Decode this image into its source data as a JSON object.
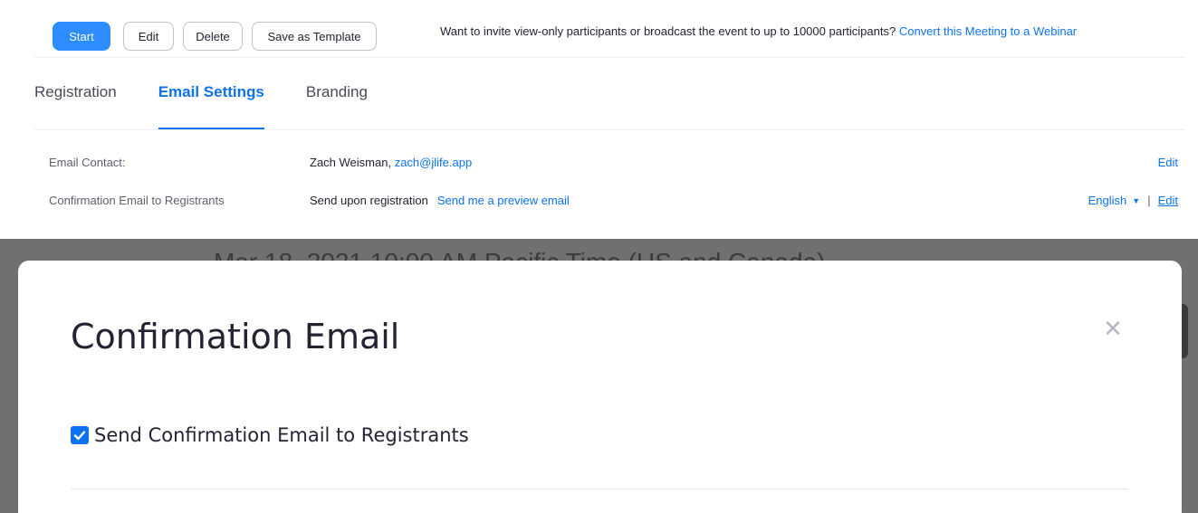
{
  "toolbar": {
    "start_label": "Start",
    "edit_label": "Edit",
    "delete_label": "Delete",
    "template_label": "Save as Template",
    "invite_text": "Want to invite view-only participants or broadcast the event to up to 10000 participants?",
    "convert_link": "Convert this Meeting to a Webinar"
  },
  "tabs": [
    {
      "label": "Registration",
      "active": false
    },
    {
      "label": "Email Settings",
      "active": true
    },
    {
      "label": "Branding",
      "active": false
    }
  ],
  "email_settings": {
    "contact": {
      "label": "Email Contact:",
      "name": "Zach Weisman,",
      "email": "zach@jlife.app",
      "edit_label": "Edit"
    },
    "confirmation": {
      "label": "Confirmation Email to Registrants",
      "status": "Send upon registration",
      "preview_link": "Send me a preview email",
      "language": "English",
      "separator": "|",
      "edit_label": "Edit"
    }
  },
  "background": {
    "partial_date_text": "Mar 18, 2021 10:00 AM Pacific Time (US and Canada)"
  },
  "modal": {
    "title": "Confirmation Email",
    "close_icon": "close-icon",
    "checkbox": {
      "label": "Send Confirmation Email to Registrants",
      "checked": true
    }
  },
  "colors": {
    "primary": "#2d8cff",
    "link": "#0e72ed",
    "overlay": "#707073"
  }
}
